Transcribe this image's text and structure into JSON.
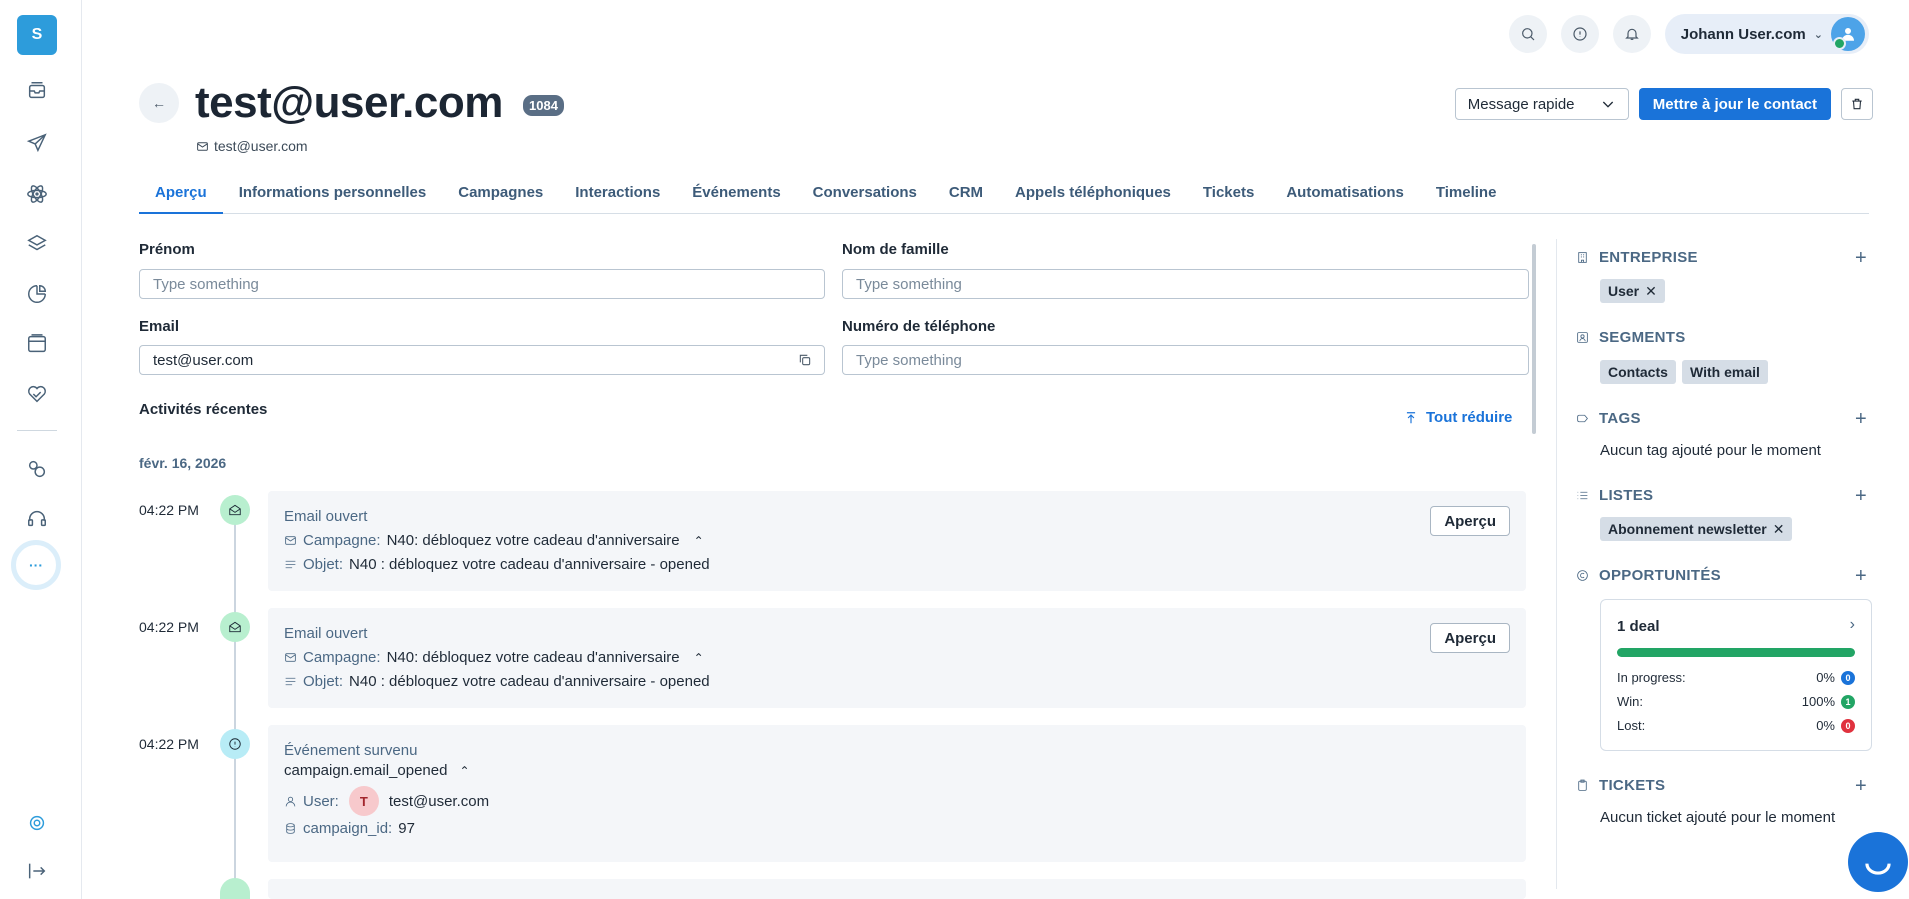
{
  "sidebar": {
    "logo_letter": "S",
    "more_label": "···"
  },
  "topbar": {
    "user_name": "Johann User.com"
  },
  "header": {
    "back_label": "←",
    "title": "test@user.com",
    "id_badge": "1084",
    "email": "test@user.com",
    "quick_message_label": "Message rapide",
    "update_button_label": "Mettre à jour le contact"
  },
  "tabs": [
    {
      "label": "Aperçu"
    },
    {
      "label": "Informations personnelles"
    },
    {
      "label": "Campagnes"
    },
    {
      "label": "Interactions"
    },
    {
      "label": "Événements"
    },
    {
      "label": "Conversations"
    },
    {
      "label": "CRM"
    },
    {
      "label": "Appels téléphoniques"
    },
    {
      "label": "Tickets"
    },
    {
      "label": "Automatisations"
    },
    {
      "label": "Timeline"
    }
  ],
  "form": {
    "first_name_label": "Prénom",
    "first_name_placeholder": "Type something",
    "last_name_label": "Nom de famille",
    "last_name_placeholder": "Type something",
    "email_label": "Email",
    "email_value": "test@user.com",
    "phone_label": "Numéro de téléphone",
    "phone_placeholder": "Type something"
  },
  "activities": {
    "title": "Activités récentes",
    "collapse_all": "Tout réduire",
    "date": "févr. 16, 2026",
    "items": [
      {
        "time": "04:22 PM",
        "title": "Email ouvert",
        "campaign_key": "Campagne:",
        "campaign_value": "N40: débloquez votre cadeau d'anniversaire",
        "subject_key": "Objet:",
        "subject_value": "N40 : débloquez votre cadeau d'anniversaire - opened",
        "button": "Aperçu"
      },
      {
        "time": "04:22 PM",
        "title": "Email ouvert",
        "campaign_key": "Campagne:",
        "campaign_value": "N40: débloquez votre cadeau d'anniversaire",
        "subject_key": "Objet:",
        "subject_value": "N40 : débloquez votre cadeau d'anniversaire - opened",
        "button": "Aperçu"
      },
      {
        "time": "04:22 PM",
        "title": "Événement survenu",
        "event_name": "campaign.email_opened",
        "user_key": "User:",
        "user_initial": "T",
        "user_value": "test@user.com",
        "campaign_id_key": "campaign_id:",
        "campaign_id_value": "97"
      }
    ]
  },
  "right_panel": {
    "company": {
      "title": "ENTREPRISE",
      "chips": [
        "User"
      ]
    },
    "segments": {
      "title": "SEGMENTS",
      "chips": [
        "Contacts",
        "With email"
      ]
    },
    "tags": {
      "title": "TAGS",
      "empty": "Aucun tag ajouté pour le moment"
    },
    "lists": {
      "title": "LISTES",
      "chips": [
        "Abonnement newsletter"
      ]
    },
    "opportunities": {
      "title": "OPPORTUNITÉS",
      "deal_title": "1 deal",
      "win_fraction": 1.0,
      "rows": [
        {
          "label": "In progress:",
          "percent": "0%",
          "count": "0",
          "color": "#1a73d9"
        },
        {
          "label": "Win:",
          "percent": "100%",
          "count": "1",
          "color": "#22a565"
        },
        {
          "label": "Lost:",
          "percent": "0%",
          "count": "0",
          "color": "#e0323e"
        }
      ]
    },
    "tickets": {
      "title": "TICKETS",
      "empty": "Aucun ticket ajouté pour le moment"
    }
  },
  "colors": {
    "accent": "#1a73d9",
    "success": "#22a565",
    "danger": "#e0323e"
  }
}
